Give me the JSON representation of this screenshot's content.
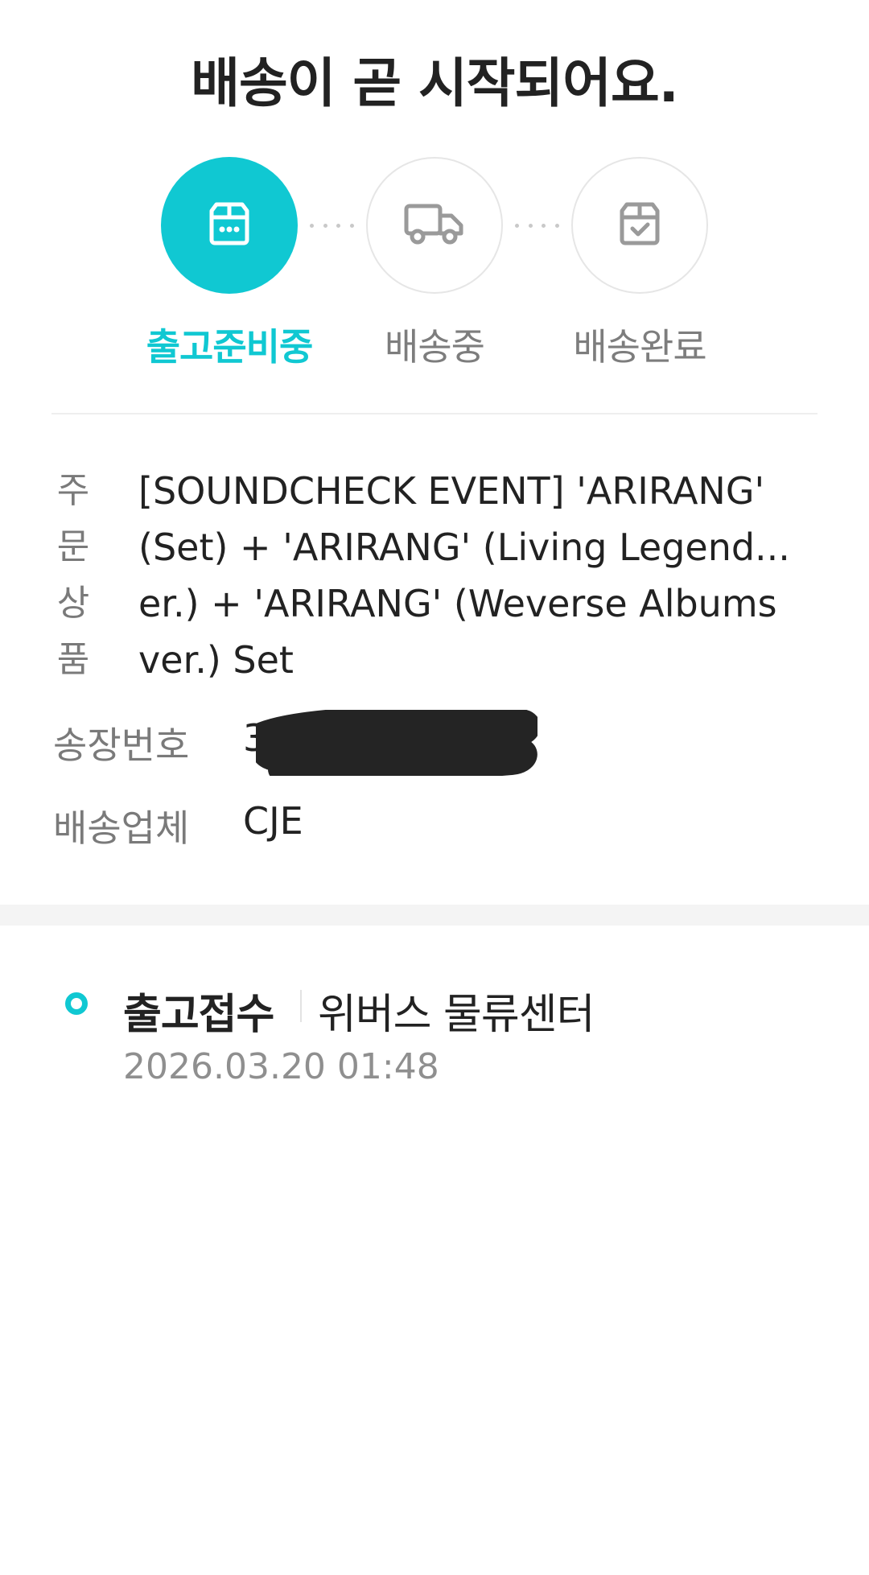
{
  "headline": "배송이 곧 시작되어요.",
  "steps": [
    {
      "label": "출고준비중",
      "icon": "box-dots-icon",
      "active": true
    },
    {
      "label": "배송중",
      "icon": "truck-icon",
      "active": false
    },
    {
      "label": "배송완료",
      "icon": "box-check-icon",
      "active": false
    }
  ],
  "details": {
    "product_key_chars": [
      "주",
      "문",
      "상",
      "품"
    ],
    "product_lines": [
      "[SOUNDCHECK EVENT] 'ARIRANG'",
      "(Set) + 'ARIRANG' (Living Legend...",
      "er.) + 'ARIRANG' (Weverse Albums",
      "ver.) Set"
    ],
    "tracking_label": "송장번호",
    "tracking_value": "3",
    "carrier_label": "배송업체",
    "carrier_value": "CJE"
  },
  "timeline": {
    "status": "출고접수",
    "location": "위버스 물류센터",
    "time": "2026.03.20 01:48"
  },
  "colors": {
    "accent": "#10c8d2",
    "text": "#222222",
    "muted": "#7a7a7a"
  }
}
